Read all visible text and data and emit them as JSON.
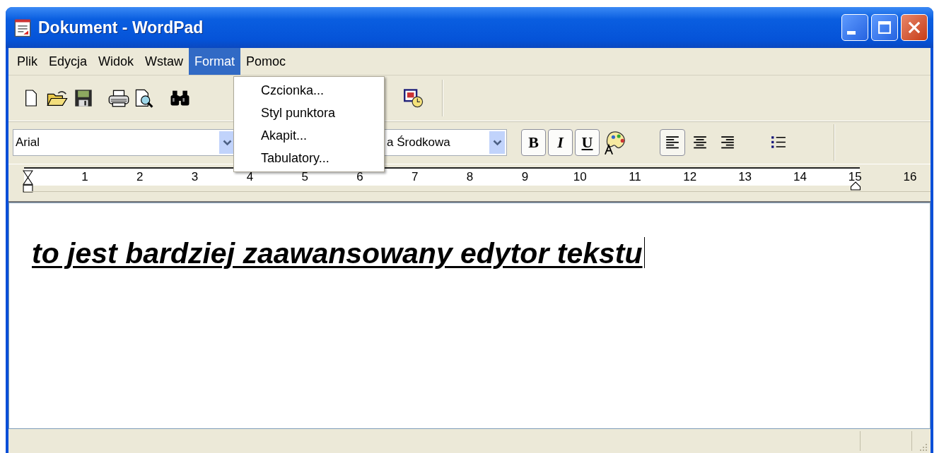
{
  "window": {
    "title": "Dokument - WordPad"
  },
  "menu_bar": [
    {
      "label": "Plik",
      "selected": false
    },
    {
      "label": "Edycja",
      "selected": false
    },
    {
      "label": "Widok",
      "selected": false
    },
    {
      "label": "Wstaw",
      "selected": false
    },
    {
      "label": "Format",
      "selected": true
    },
    {
      "label": "Pomoc",
      "selected": false
    }
  ],
  "format_menu": {
    "items": [
      "Czcionka...",
      "Styl punktora",
      "Akapit...",
      "Tabulatory..."
    ]
  },
  "format_bar": {
    "font": "Arial",
    "script": "a Środkowa",
    "style_buttons": [
      {
        "kind": "bold",
        "label": "B",
        "on": true
      },
      {
        "kind": "italic",
        "label": "I",
        "on": true
      },
      {
        "kind": "underline",
        "label": "U",
        "on": true
      }
    ],
    "align_buttons": [
      {
        "kind": "left",
        "selected": true
      },
      {
        "kind": "center",
        "selected": false
      },
      {
        "kind": "right",
        "selected": false
      }
    ]
  },
  "ruler": {
    "numbers": [
      "1",
      "2",
      "3",
      "4",
      "5",
      "6",
      "7",
      "8",
      "9",
      "10",
      "11",
      "12",
      "13",
      "14",
      "15",
      "16"
    ]
  },
  "document": {
    "text": "to jest bardziej zaawansowany edytor tekstu",
    "bold": true,
    "italic": true,
    "underline": true
  }
}
